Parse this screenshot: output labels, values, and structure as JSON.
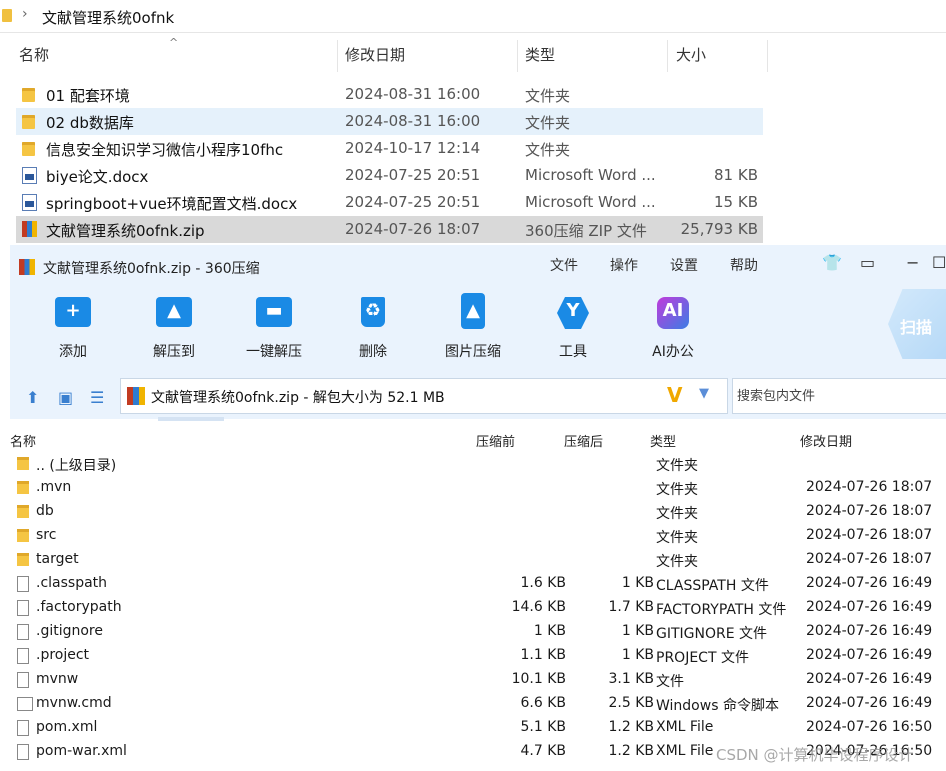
{
  "explorer": {
    "breadcrumb": "文献管理系统0ofnk",
    "columns": {
      "name": "名称",
      "date": "修改日期",
      "type": "类型",
      "size": "大小"
    },
    "files": [
      {
        "name": "01 配套环境",
        "date": "2024-08-31 16:00",
        "type": "文件夹",
        "size": "",
        "icon": "folder-icon",
        "state": ""
      },
      {
        "name": "02 db数据库",
        "date": "2024-08-31 16:00",
        "type": "文件夹",
        "size": "",
        "icon": "folder-icon",
        "state": "hover"
      },
      {
        "name": "信息安全知识学习微信小程序10fhc",
        "date": "2024-10-17 12:14",
        "type": "文件夹",
        "size": "",
        "icon": "folder-icon",
        "state": ""
      },
      {
        "name": "biye论文.docx",
        "date": "2024-07-25 20:51",
        "type": "Microsoft Word ...",
        "size": "81 KB",
        "icon": "word-doc-icon",
        "state": ""
      },
      {
        "name": "springboot+vue环境配置文档.docx",
        "date": "2024-07-25 20:51",
        "type": "Microsoft Word ...",
        "size": "15 KB",
        "icon": "word-doc-icon",
        "state": ""
      },
      {
        "name": "文献管理系统0ofnk.zip",
        "date": "2024-07-26 18:07",
        "type": "360压缩 ZIP 文件",
        "size": "25,793 KB",
        "icon": "zip-archive-icon",
        "state": "selected"
      }
    ]
  },
  "archiver": {
    "title": "文献管理系统0ofnk.zip - 360压缩",
    "menu": [
      "文件",
      "操作",
      "设置",
      "帮助"
    ],
    "tools": [
      "添加",
      "解压到",
      "一键解压",
      "删除",
      "图片压缩",
      "工具",
      "AI办公"
    ],
    "scan_label": "扫描",
    "path_text": "文献管理系统0ofnk.zip - 解包大小为 52.1 MB",
    "search_placeholder": "搜索包内文件",
    "columns": {
      "name": "名称",
      "before": "压缩前",
      "after": "压缩后",
      "type": "类型",
      "date": "修改日期"
    },
    "entries": [
      {
        "name": ".. (上级目录)",
        "before": "",
        "after": "",
        "type": "文件夹",
        "date": "",
        "icon": "folder"
      },
      {
        "name": ".mvn",
        "before": "",
        "after": "",
        "type": "文件夹",
        "date": "2024-07-26 18:07",
        "icon": "folder"
      },
      {
        "name": "db",
        "before": "",
        "after": "",
        "type": "文件夹",
        "date": "2024-07-26 18:07",
        "icon": "folder"
      },
      {
        "name": "src",
        "before": "",
        "after": "",
        "type": "文件夹",
        "date": "2024-07-26 18:07",
        "icon": "folder"
      },
      {
        "name": "target",
        "before": "",
        "after": "",
        "type": "文件夹",
        "date": "2024-07-26 18:07",
        "icon": "folder"
      },
      {
        "name": ".classpath",
        "before": "1.6 KB",
        "after": "1 KB",
        "type": "CLASSPATH 文件",
        "date": "2024-07-26 16:49",
        "icon": "file"
      },
      {
        "name": ".factorypath",
        "before": "14.6 KB",
        "after": "1.7 KB",
        "type": "FACTORYPATH 文件",
        "date": "2024-07-26 16:49",
        "icon": "file"
      },
      {
        "name": ".gitignore",
        "before": "1 KB",
        "after": "1 KB",
        "type": "GITIGNORE 文件",
        "date": "2024-07-26 16:49",
        "icon": "file"
      },
      {
        "name": ".project",
        "before": "1.1 KB",
        "after": "1 KB",
        "type": "PROJECT 文件",
        "date": "2024-07-26 16:49",
        "icon": "file"
      },
      {
        "name": "mvnw",
        "before": "10.1 KB",
        "after": "3.1 KB",
        "type": "文件",
        "date": "2024-07-26 16:49",
        "icon": "file"
      },
      {
        "name": "mvnw.cmd",
        "before": "6.6 KB",
        "after": "2.5 KB",
        "type": "Windows 命令脚本",
        "date": "2024-07-26 16:49",
        "icon": "cmd"
      },
      {
        "name": "pom.xml",
        "before": "5.1 KB",
        "after": "1.2 KB",
        "type": "XML File",
        "date": "2024-07-26 16:50",
        "icon": "file"
      },
      {
        "name": "pom-war.xml",
        "before": "4.7 KB",
        "after": "1.2 KB",
        "type": "XML File",
        "date": "2024-07-26 16:50",
        "icon": "file"
      }
    ]
  },
  "watermark": "CSDN @计算机毕设程序设计",
  "colors": {
    "accent": "#1a8ae5",
    "toolbar_bg": "#eaf3fd",
    "selected_row": "#d9d9d9",
    "hover_row": "#e5f1fb"
  }
}
